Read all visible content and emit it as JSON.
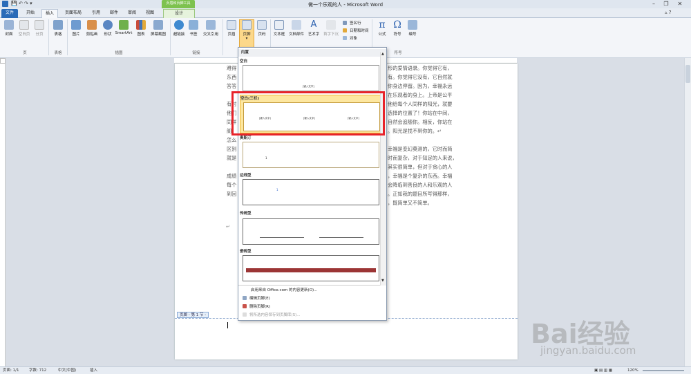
{
  "window": {
    "title": "做一个乐观的人 - Microsoft Word",
    "context_tab": "页眉和页脚工具"
  },
  "tabs": [
    "文件",
    "开始",
    "插入",
    "页面布局",
    "引用",
    "邮件",
    "审阅",
    "视图",
    "设计"
  ],
  "ribbon": {
    "buttons": [
      "封面",
      "空白页",
      "分页",
      "表格",
      "图片",
      "剪贴画",
      "形状",
      "SmartArt",
      "图表",
      "屏幕截图",
      "超链接",
      "书签",
      "交叉引用",
      "页眉",
      "页脚",
      "页码",
      "文本框",
      "文档部件",
      "艺术字",
      "首字下沉",
      "公式",
      "符号",
      "编号"
    ],
    "side_items": [
      "签名行",
      "日期和时间",
      "对象"
    ],
    "groups": [
      "页",
      "表格",
      "插图",
      "链接",
      "符号"
    ]
  },
  "gallery": {
    "section_header": "内置",
    "items": [
      "空白",
      "空白(三栏)",
      "奥斯汀",
      "边线型",
      "传统型",
      "瓷砖型"
    ],
    "placeholder": "[键入文字]",
    "footer_items": [
      "启用来自 Office.com 的内容更新(O)...",
      "编辑页脚(E)",
      "删除页脚(R)",
      "将所选内容保存到页脚库(S)..."
    ]
  },
  "document": {
    "left_lines": [
      "难得",
      "东西",
      "答答",
      "",
      "有时",
      "他们",
      "同样",
      "阁，",
      "怎么",
      "区别",
      "就是",
      "",
      "成绩",
      "每个",
      "到回"
    ],
    "right_lines": [
      "形的爱情语录。你觉得它有，",
      "有。你觉得它没有，它自然就",
      "你身边停留。因为，幸福永远",
      "在乐观者的身上。上帝是公平",
      "他给每个人同样的阳光，就要",
      "选择的位置了！你站在中间，",
      "自然会追随你。相反，你站在",
      "。阳光是找不到你的。↵",
      "",
      "幸福是变幻莫测的，它时而简",
      "时而复杂，对于知足的人来说，",
      "其实很简单，但对于贪心的人",
      "，幸福是个复杂的东西。幸福",
      "会降临到善良的人和乐观的人",
      "。正如我的题目所写得那样，",
      "，既简单又不简单。"
    ],
    "footer_label": "页脚 - 第 1 节 -"
  },
  "status": {
    "page": "页面: 1/1",
    "words": "字数: 712",
    "lang": "中文(中国)",
    "mode": "插入",
    "zoom": "120%"
  },
  "watermark": {
    "brand": "Bai经验",
    "url": "jingyan.baidu.com"
  },
  "colors": {
    "accent": "#2a6bb8",
    "highlight": "#fde7a0",
    "red_box": "#e8232a",
    "context_green": "#7dc24e"
  }
}
